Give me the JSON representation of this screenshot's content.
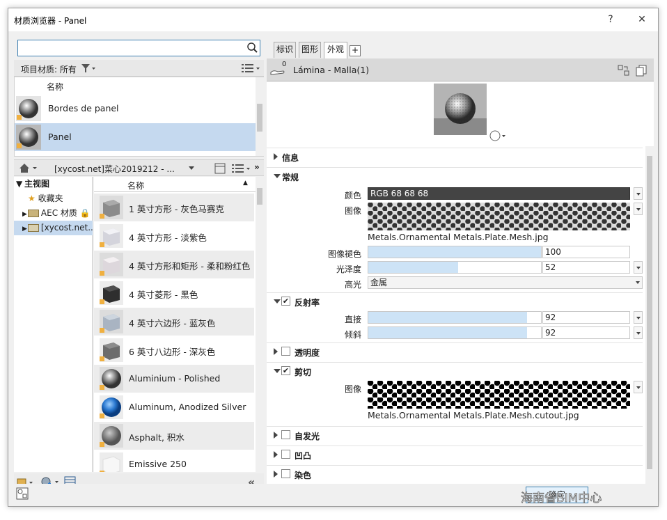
{
  "window": {
    "title": "材质浏览器 - Panel",
    "help_label": "?",
    "close_label": "✕"
  },
  "browser": {
    "search_placeholder": "",
    "project_filter_label": "项目材质: 所有",
    "column_name": "名称",
    "project_materials": [
      {
        "name": "Bordes de panel"
      },
      {
        "name": "Panel"
      }
    ],
    "breadcrumb": "[xycost.net]菜心2019212 - ...",
    "tree": [
      {
        "label": "主视图"
      },
      {
        "label": "收藏夹"
      },
      {
        "label": "AEC 材质"
      },
      {
        "label": "[xycost.net..."
      }
    ],
    "library_column_name": "名称",
    "library_materials": [
      {
        "name": "1 英寸方形 - 灰色马赛克"
      },
      {
        "name": "4  英寸方形 - 淡紫色"
      },
      {
        "name": "4 英寸方形和矩形 - 柔和粉红色"
      },
      {
        "name": "4 英寸菱形 - 黑色"
      },
      {
        "name": "4 英寸六边形 - 蓝灰色"
      },
      {
        "name": "6 英寸八边形 - 深灰色"
      },
      {
        "name": "Aluminium - Polished"
      },
      {
        "name": "Aluminum, Anodized Silver"
      },
      {
        "name": "Asphalt, 积水"
      },
      {
        "name": "Emissive 250"
      }
    ]
  },
  "editor": {
    "tabs": [
      {
        "label": "标识"
      },
      {
        "label": "图形"
      },
      {
        "label": "外观"
      }
    ],
    "add_tab_label": "+",
    "asset_count": "0",
    "asset_name": "Lámina - Malla(1)",
    "sections": {
      "info": "信息",
      "generic": "常规",
      "reflectivity": "反射率",
      "transparency": "透明度",
      "cutout": "剪切",
      "self_illumination": "自发光",
      "bump": "凹凸",
      "tint": "染色"
    },
    "generic": {
      "color_label": "颜色",
      "color_value": "RGB 68 68 68",
      "image_label": "图像",
      "image_file": "Metals.Ornamental Metals.Plate.Mesh.jpg",
      "image_fade_label": "图像褪色",
      "image_fade_value": "100",
      "image_fade_percent": 100,
      "glossiness_label": "光泽度",
      "glossiness_value": "52",
      "glossiness_percent": 52,
      "highlights_label": "高光",
      "highlights_value": "金属"
    },
    "reflectivity": {
      "direct_label": "直接",
      "direct_value": "92",
      "direct_percent": 92,
      "oblique_label": "倾斜",
      "oblique_value": "92",
      "oblique_percent": 92
    },
    "cutout": {
      "image_label": "图像",
      "image_file": "Metals.Ornamental Metals.Plate.Mesh.cutout.jpg"
    }
  },
  "footer": {
    "ok_label": "确定",
    "watermark": "海南省BIM中心"
  },
  "colors": {
    "selection": "#c5d9ef",
    "slider_fill": "#cde3f6",
    "color_swatch": "#444444"
  }
}
